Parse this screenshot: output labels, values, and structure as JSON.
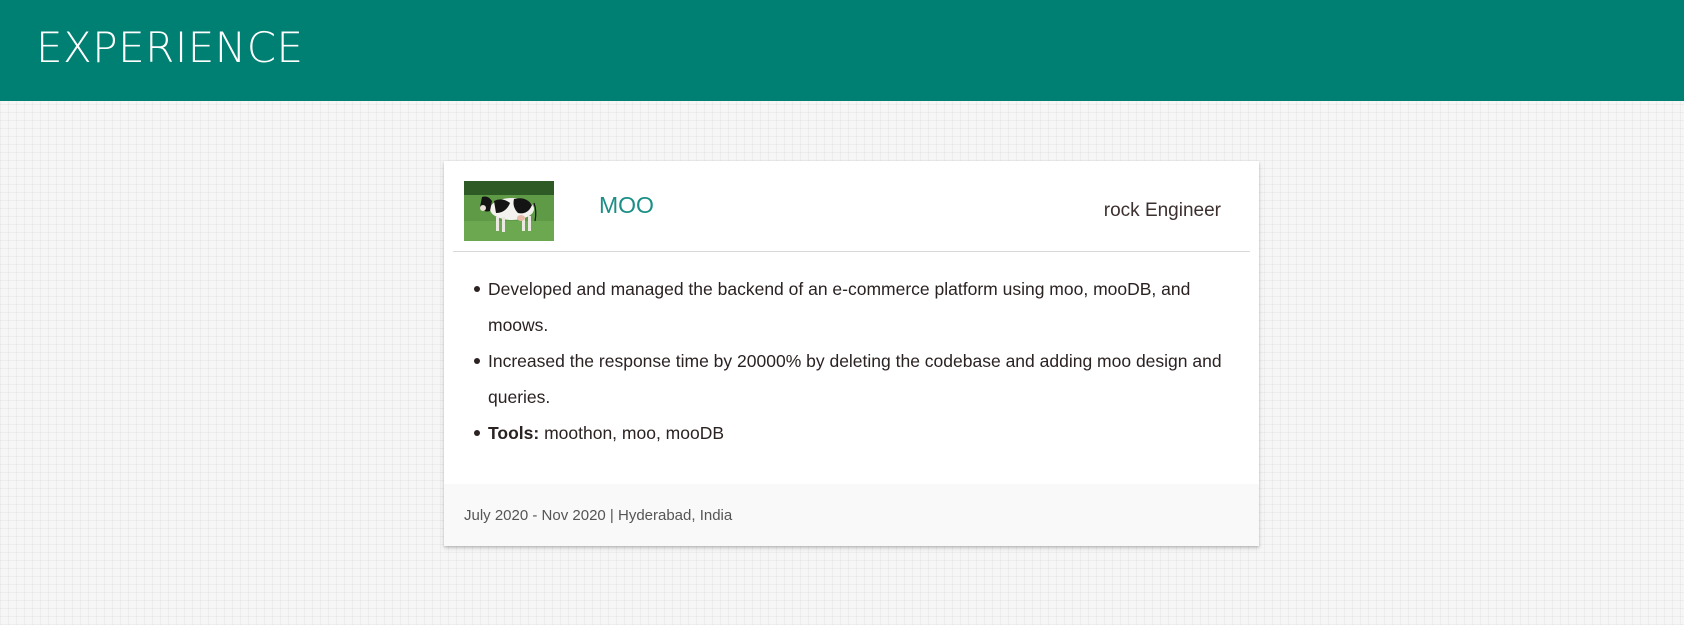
{
  "header": {
    "title": "EXPERIENCE",
    "background_color": "#008073"
  },
  "experience": {
    "logo": "cow-photo-logo",
    "company": "MOO",
    "role": "rock Engineer",
    "bullets": [
      "Developed and managed the backend of an e-commerce platform using moo, mooDB, and moows.",
      "Increased the response time by 20000% by deleting the codebase and adding moo design and queries."
    ],
    "tools_label": "Tools:",
    "tools_value": "moothon, moo, mooDB",
    "footer": "July 2020 - Nov 2020 | Hyderabad, India",
    "company_color": "#1b8f86"
  }
}
